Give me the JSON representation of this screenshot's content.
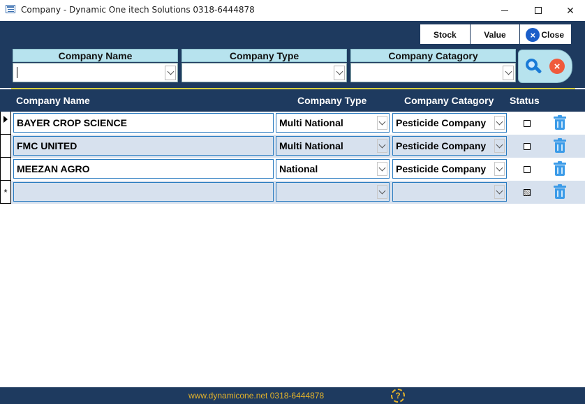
{
  "window": {
    "title": "Company - Dynamic One itech Solutions 0318-6444878",
    "minimize": "–",
    "maximize": "□",
    "close": "✕"
  },
  "toolbar": {
    "stock_label": "Stock",
    "value_label": "Value",
    "close_label": "Close",
    "close_glyph": "×"
  },
  "filters": {
    "company_name_label": "Company Name",
    "company_type_label": "Company Type",
    "company_category_label": "Company Catagory",
    "company_name_value": "",
    "company_type_value": "",
    "company_category_value": ""
  },
  "actions": {
    "clear_glyph": "×"
  },
  "columns": {
    "name": "Company Name",
    "type": "Company Type",
    "category": "Company Catagory",
    "status": "Status"
  },
  "rows": [
    {
      "name": "BAYER CROP SCIENCE",
      "type": "Multi National",
      "category": "Pesticide Company",
      "status": false
    },
    {
      "name": "FMC UNITED",
      "type": "Multi National",
      "category": "Pesticide Company",
      "status": false
    },
    {
      "name": "MEEZAN AGRO",
      "type": "National",
      "category": "Pesticide Company",
      "status": false
    },
    {
      "name": "",
      "type": "",
      "category": "",
      "status": null
    }
  ],
  "new_row_marker": "*",
  "footer": {
    "text": "www.dynamicone.net 0318-6444878",
    "help_glyph": "?"
  },
  "colors": {
    "header_bg": "#1e3a5f",
    "label_bg": "#b7e3ee",
    "footer_text": "#e6b42a",
    "accent_blue": "#1b5ec9",
    "clear_red": "#ef5a3c"
  }
}
